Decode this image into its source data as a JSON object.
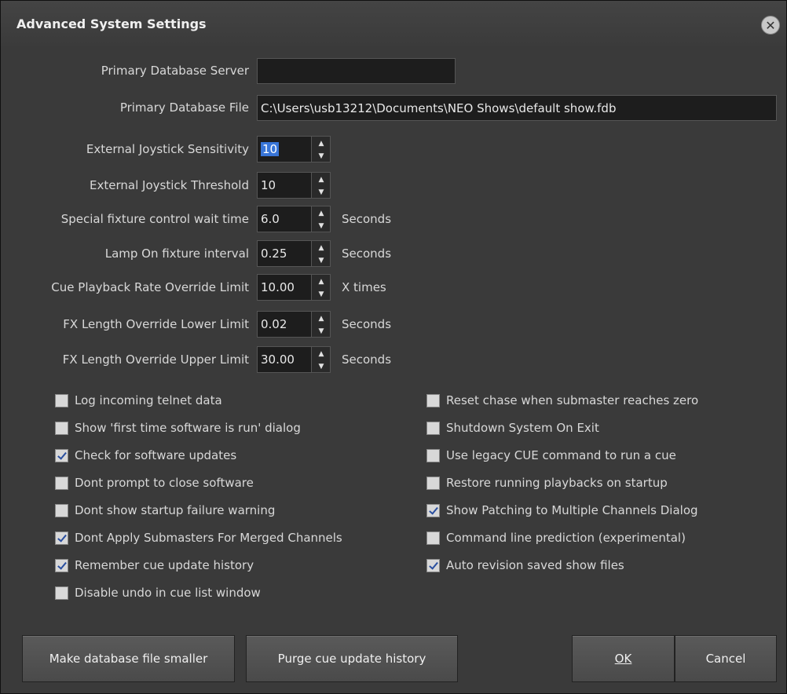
{
  "window": {
    "title": "Advanced System Settings"
  },
  "fields": {
    "primary_db_server_label": "Primary Database Server",
    "primary_db_server_value": "",
    "primary_db_file_label": "Primary Database File",
    "primary_db_file_value": "C:\\Users\\usb13212\\Documents\\NEO Shows\\default show.fdb"
  },
  "spinners": [
    {
      "label": "External Joystick Sensitivity",
      "value": "10",
      "unit": ""
    },
    {
      "label": "External Joystick Threshold",
      "value": "10",
      "unit": ""
    },
    {
      "label": "Special fixture control wait time",
      "value": "6.0",
      "unit": "Seconds"
    },
    {
      "label": "Lamp On fixture interval",
      "value": "0.25",
      "unit": "Seconds"
    },
    {
      "label": "Cue Playback Rate Override Limit",
      "value": "10.00",
      "unit": "X times"
    },
    {
      "label": "FX Length Override Lower Limit",
      "value": "0.02",
      "unit": "Seconds"
    },
    {
      "label": "FX Length Override Upper Limit",
      "value": "30.00",
      "unit": "Seconds"
    }
  ],
  "checkboxes_left": [
    {
      "label": "Log incoming telnet data",
      "checked": false
    },
    {
      "label": "Show 'first time software is run' dialog",
      "checked": false
    },
    {
      "label": "Check for software updates",
      "checked": true
    },
    {
      "label": "Dont prompt to close software",
      "checked": false
    },
    {
      "label": "Dont show startup failure warning",
      "checked": false
    },
    {
      "label": "Dont Apply Submasters For Merged Channels",
      "checked": true
    },
    {
      "label": "Remember cue update history",
      "checked": true
    },
    {
      "label": "Disable undo in cue list window",
      "checked": false
    }
  ],
  "checkboxes_right": [
    {
      "label": "Reset chase when submaster reaches zero",
      "checked": false
    },
    {
      "label": "Shutdown System On Exit",
      "checked": false
    },
    {
      "label": "Use legacy CUE command to run a cue",
      "checked": false
    },
    {
      "label": "Restore running playbacks on startup",
      "checked": false
    },
    {
      "label": "Show Patching to Multiple Channels Dialog",
      "checked": true
    },
    {
      "label": "Command line prediction (experimental)",
      "checked": false
    },
    {
      "label": "Auto revision saved show files",
      "checked": true
    }
  ],
  "buttons": {
    "make_smaller": "Make database file smaller",
    "purge": "Purge cue update history",
    "ok": "OK",
    "cancel": "Cancel"
  },
  "icons": {
    "close": "close-icon",
    "spin_up": "arrow-up-icon",
    "spin_down": "arrow-down-icon"
  }
}
